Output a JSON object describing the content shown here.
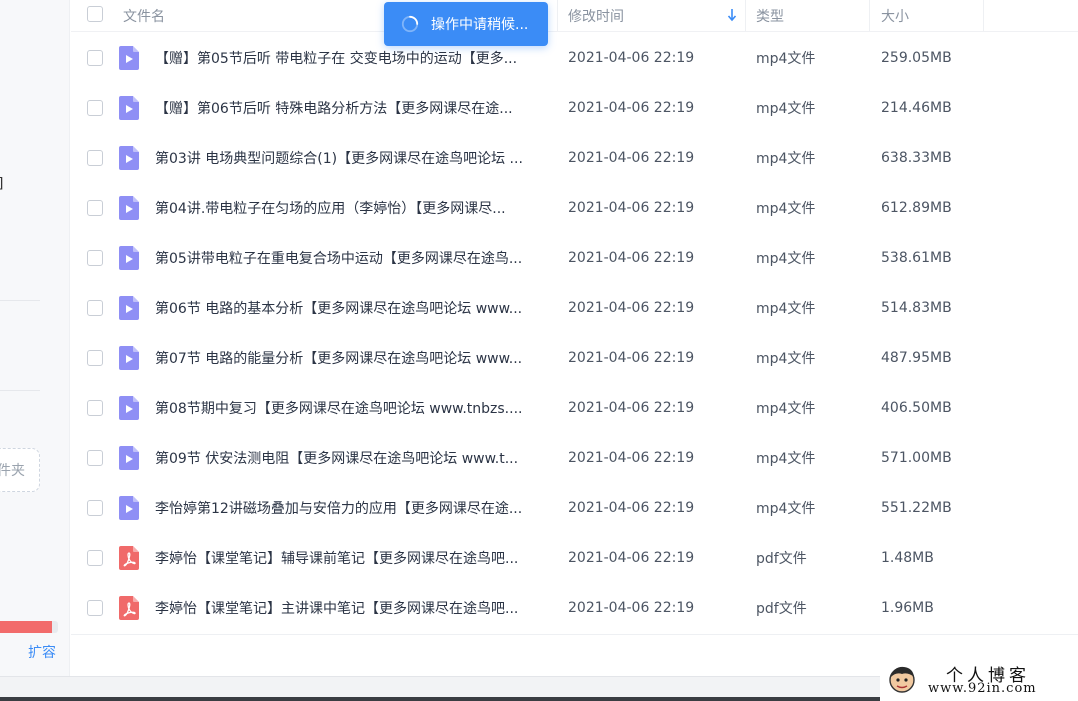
{
  "sidebar": {
    "bracket_text": "]",
    "new_folder_label": "件夹",
    "storage_used_fraction": 0.9,
    "expand_label": "扩容"
  },
  "header": {
    "col_name": "文件名",
    "col_modified": "修改时间",
    "col_type": "类型",
    "col_size": "大小"
  },
  "toast": {
    "text": "操作中请稍候..."
  },
  "colors": {
    "accent": "#3b8cf6",
    "video_icon": "#8f8ff5",
    "pdf_icon": "#f06a6a",
    "storage_bar": "#f26b6b"
  },
  "files": [
    {
      "name": "【赠】第05节后听 带电粒子在 交变电场中的运动【更多...",
      "modified": "2021-04-06 22:19",
      "type": "mp4文件",
      "size": "259.05MB",
      "icon": "video-file-icon"
    },
    {
      "name": "【赠】第06节后听 特殊电路分析方法【更多网课尽在途...",
      "modified": "2021-04-06 22:19",
      "type": "mp4文件",
      "size": "214.46MB",
      "icon": "video-file-icon"
    },
    {
      "name": "第03讲 电场典型问题综合(1)【更多网课尽在途鸟吧论坛 ...",
      "modified": "2021-04-06 22:19",
      "type": "mp4文件",
      "size": "638.33MB",
      "icon": "video-file-icon"
    },
    {
      "name": "第04讲.带电粒子在匀场的应用（李婷怡）【更多网课尽...",
      "modified": "2021-04-06 22:19",
      "type": "mp4文件",
      "size": "612.89MB",
      "icon": "video-file-icon"
    },
    {
      "name": "第05讲带电粒子在重电复合场中运动【更多网课尽在途鸟...",
      "modified": "2021-04-06 22:19",
      "type": "mp4文件",
      "size": "538.61MB",
      "icon": "video-file-icon"
    },
    {
      "name": "第06节 电路的基本分析【更多网课尽在途鸟吧论坛 www...",
      "modified": "2021-04-06 22:19",
      "type": "mp4文件",
      "size": "514.83MB",
      "icon": "video-file-icon"
    },
    {
      "name": "第07节 电路的能量分析【更多网课尽在途鸟吧论坛 www...",
      "modified": "2021-04-06 22:19",
      "type": "mp4文件",
      "size": "487.95MB",
      "icon": "video-file-icon"
    },
    {
      "name": "第08节期中复习【更多网课尽在途鸟吧论坛 www.tnbzs....",
      "modified": "2021-04-06 22:19",
      "type": "mp4文件",
      "size": "406.50MB",
      "icon": "video-file-icon"
    },
    {
      "name": "第09节 伏安法测电阻【更多网课尽在途鸟吧论坛 www.t...",
      "modified": "2021-04-06 22:19",
      "type": "mp4文件",
      "size": "571.00MB",
      "icon": "video-file-icon"
    },
    {
      "name": "李怡婷第12讲磁场叠加与安倍力的应用【更多网课尽在途...",
      "modified": "2021-04-06 22:19",
      "type": "mp4文件",
      "size": "551.22MB",
      "icon": "video-file-icon"
    },
    {
      "name": "李婷怡【课堂笔记】辅导课前笔记【更多网课尽在途鸟吧...",
      "modified": "2021-04-06 22:19",
      "type": "pdf文件",
      "size": "1.48MB",
      "icon": "pdf-file-icon"
    },
    {
      "name": "李婷怡【课堂笔记】主讲课中笔记【更多网课尽在途鸟吧...",
      "modified": "2021-04-06 22:19",
      "type": "pdf文件",
      "size": "1.96MB",
      "icon": "pdf-file-icon"
    }
  ],
  "watermark": {
    "title": "个人博客",
    "url": "www.92in.com"
  }
}
